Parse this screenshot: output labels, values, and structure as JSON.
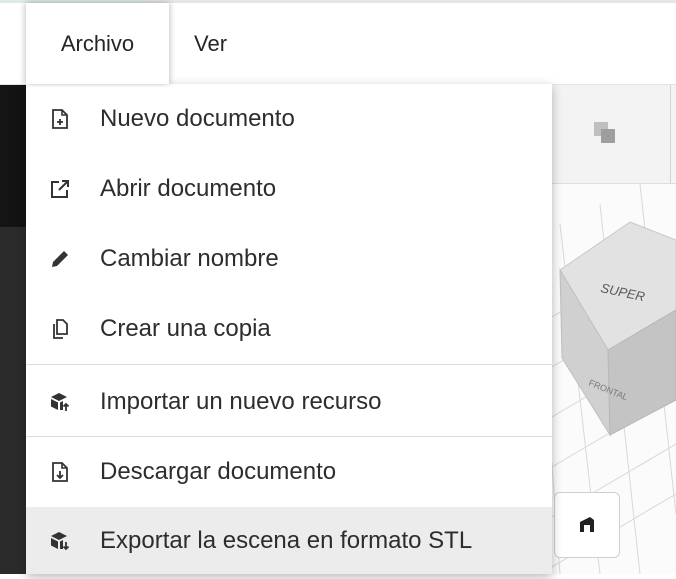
{
  "menubar": {
    "items": [
      {
        "label": "Archivo",
        "active": true
      },
      {
        "label": "Ver",
        "active": false
      }
    ]
  },
  "file_menu": {
    "groups": [
      [
        {
          "label": "Nuevo documento",
          "icon": "new-document-icon"
        },
        {
          "label": "Abrir documento",
          "icon": "open-external-icon"
        },
        {
          "label": "Cambiar nombre",
          "icon": "pencil-icon"
        },
        {
          "label": "Crear una copia",
          "icon": "copy-icon"
        }
      ],
      [
        {
          "label": "Importar un nuevo recurso",
          "icon": "import-cube-icon"
        }
      ],
      [
        {
          "label": "Descargar documento",
          "icon": "download-document-icon"
        },
        {
          "label": "Exportar la escena en formato STL",
          "icon": "export-cube-icon",
          "hovered": true
        }
      ]
    ]
  },
  "viewport": {
    "cube_faces": [
      "SUPER",
      "FRONTAL"
    ]
  },
  "colors": {
    "text": "#2d2d2d",
    "hover": "#ececec",
    "divider": "#dcdcdc",
    "icon": "#333333"
  }
}
